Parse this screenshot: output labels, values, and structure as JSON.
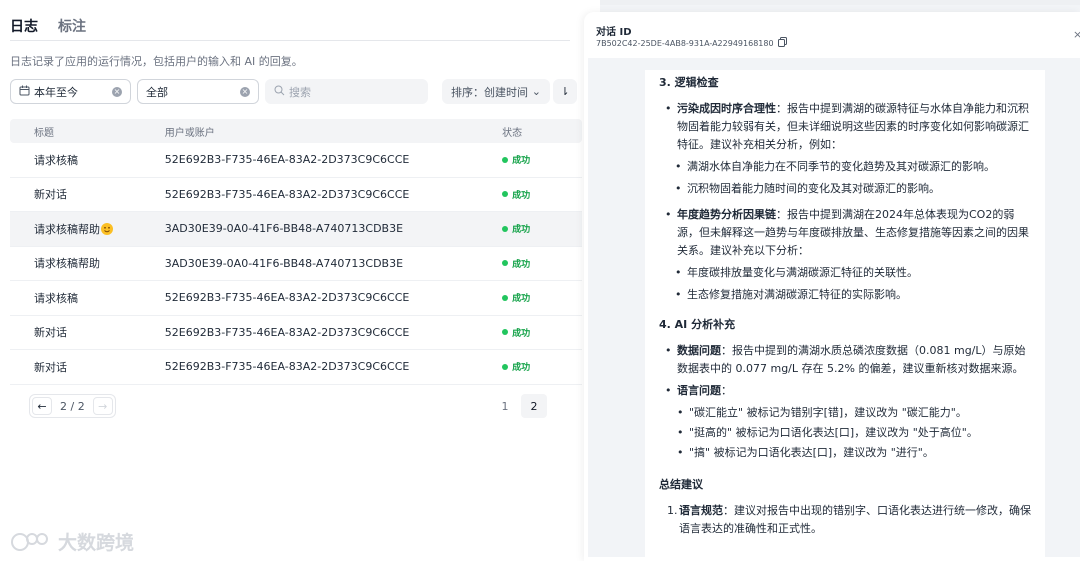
{
  "tabs": [
    "日志",
    "标注"
  ],
  "description": "日志记录了应用的运行情况，包括用户的输入和 AI 的回复。",
  "filters": {
    "date": "本年至今",
    "all": "全部",
    "search_placeholder": "搜索",
    "sort": "排序：创建时间",
    "clear_icon": "×",
    "chevron_icon": "⌄",
    "sort_dir_icon": "⇂"
  },
  "table": {
    "headers": [
      "标题",
      "用户或账户",
      "状态"
    ],
    "rows": [
      {
        "title": "请求核稿",
        "user": "52E692B3-F735-46EA-83A2-2D373C9C6CCE",
        "status": "成功"
      },
      {
        "title": "新对话",
        "user": "52E692B3-F735-46EA-83A2-2D373C9C6CCE",
        "status": "成功"
      },
      {
        "title": "请求核稿帮助",
        "user": "3AD30E39-0A0-41F6-BB48-A740713CDB3E",
        "status": "成功"
      },
      {
        "title": "请求核稿帮助",
        "user": "3AD30E39-0A0-41F6-BB48-A740713CDB3E",
        "status": "成功"
      },
      {
        "title": "请求核稿",
        "user": "52E692B3-F735-46EA-83A2-2D373C9C6CCE",
        "status": "成功"
      },
      {
        "title": "新对话",
        "user": "52E692B3-F735-46EA-83A2-2D373C9C6CCE",
        "status": "成功"
      },
      {
        "title": "新对话",
        "user": "52E692B3-F735-46EA-83A2-2D373C9C6CCE",
        "status": "成功"
      }
    ]
  },
  "pagination": {
    "prev": "←",
    "next": "→",
    "text": "2 / 2",
    "pages": [
      "1",
      "2"
    ],
    "active": "2"
  },
  "watermark": "大数跨境",
  "drawer": {
    "title": "对话 ID",
    "id": "7B502C42-25DE-4AB8-931A-A22949168180",
    "close": "×",
    "h_logic": "3. 逻辑检查",
    "logic_items": [
      {
        "bold": "污染成因时序合理性",
        "text": "：报告中提到满湖的碳源特征与水体自净能力和沉积物固着能力较弱有关，但未详细说明这些因素的时序变化如何影响碳源汇特征。建议补充相关分析，例如：",
        "subs": [
          "满湖水体自净能力在不同季节的变化趋势及其对碳源汇的影响。",
          "沉积物固着能力随时间的变化及其对碳源汇的影响。"
        ]
      },
      {
        "bold": "年度趋势分析因果链",
        "text": "：报告中提到满湖在2024年总体表现为CO2的弱源，但未解释这一趋势与年度碳排放量、生态修复措施等因素之间的因果关系。建议补充以下分析：",
        "subs": [
          "年度碳排放量变化与满湖碳源汇特征的关联性。",
          "生态修复措施对满湖碳源汇特征的实际影响。"
        ]
      }
    ],
    "h_ai": "4. AI 分析补充",
    "data_issue_bold": "数据问题",
    "data_issue_text": "：报告中提到的满湖水质总磷浓度数据（0.081 mg/L）与原始数据表中的 0.077 mg/L 存在 5.2% 的偏差，建议重新核对数据来源。",
    "lang_issue_bold": "语言问题",
    "lang_issue_text": "：",
    "lang_subs": [
      "\"碳汇能立\" 被标记为错别字[错]，建议改为 \"碳汇能力\"。",
      "\"挺高的\" 被标记为口语化表达[口]，建议改为 \"处于高位\"。",
      "\"搞\" 被标记为口语化表达[口]，建议改为 \"进行\"。"
    ],
    "h_summary": "总结建议",
    "summary_num": "1.",
    "summary_bold": "语言规范",
    "summary_text": "：建议对报告中出现的错别字、口语化表达进行统一修改，确保语言表达的准确性和正式性。"
  }
}
